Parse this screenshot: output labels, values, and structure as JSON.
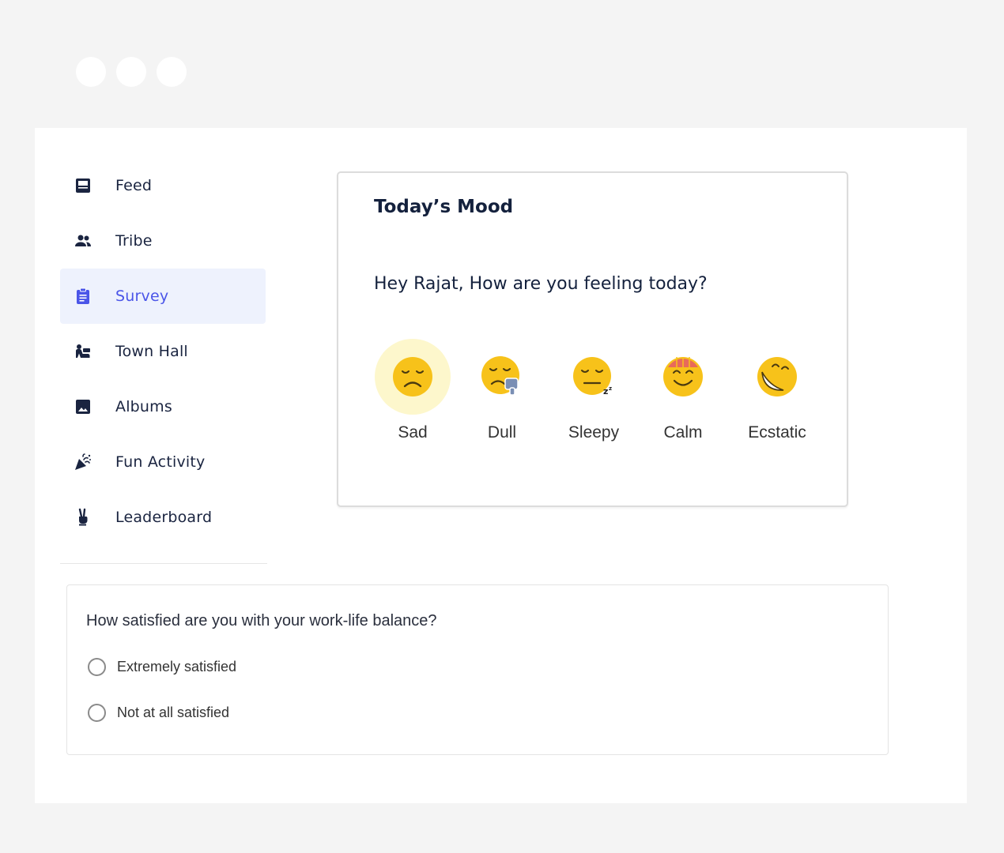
{
  "window_controls": [
    "dot",
    "dot",
    "dot"
  ],
  "sidebar": {
    "items": [
      {
        "name": "feed",
        "label": "Feed",
        "icon": "feed-icon",
        "active": false
      },
      {
        "name": "tribe",
        "label": "Tribe",
        "icon": "people-icon",
        "active": false
      },
      {
        "name": "survey",
        "label": "Survey",
        "icon": "clipboard-icon",
        "active": true
      },
      {
        "name": "town-hall",
        "label": "Town Hall",
        "icon": "town-hall-icon",
        "active": false
      },
      {
        "name": "albums",
        "label": "Albums",
        "icon": "image-icon",
        "active": false
      },
      {
        "name": "fun-activity",
        "label": "Fun Activity",
        "icon": "party-popper-icon",
        "active": false
      },
      {
        "name": "leaderboard",
        "label": "Leaderboard",
        "icon": "victory-hand-icon",
        "active": false
      }
    ]
  },
  "mood": {
    "title": "Today’s Mood",
    "question": "Hey Rajat, How are you feeling today?",
    "options": [
      {
        "label": "Sad",
        "icon": "sad-face-icon",
        "selected": true
      },
      {
        "label": "Dull",
        "icon": "dull-face-icon",
        "selected": false
      },
      {
        "label": "Sleepy",
        "icon": "sleepy-face-icon",
        "selected": false
      },
      {
        "label": "Calm",
        "icon": "calm-face-icon",
        "selected": false
      },
      {
        "label": "Ecstatic",
        "icon": "ecstatic-face-icon",
        "selected": false
      }
    ]
  },
  "survey": {
    "question": "How satisfied are you with your work-life balance?",
    "options": [
      "Extremely satisfied",
      "Not at all satisfied"
    ]
  },
  "colors": {
    "accent": "#4a55e8",
    "active_bg": "#eef2fd",
    "text_dark": "#14213d",
    "emoji_yellow": "#f7c21a",
    "selected_halo": "#fdf7cc"
  }
}
